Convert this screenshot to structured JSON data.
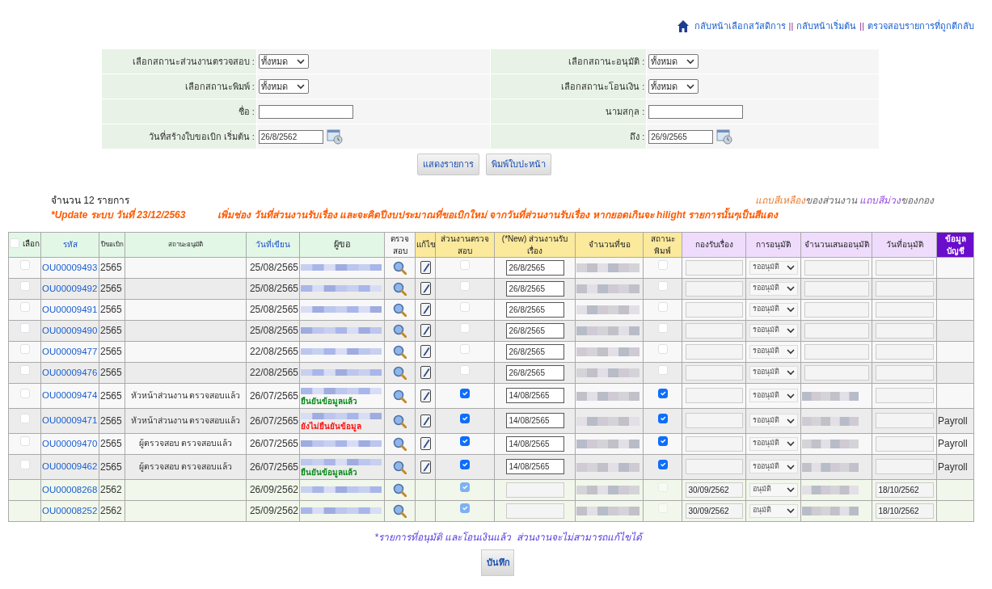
{
  "nav_links": [
    {
      "kind": "link",
      "label": "กลับหน้าเลือกสวัสดิการ"
    },
    {
      "kind": "sep",
      "label": "||"
    },
    {
      "kind": "link",
      "label": "กลับหน้าเริ่มต้น"
    },
    {
      "kind": "sep",
      "label": "||"
    },
    {
      "kind": "link",
      "label": "ตรวจสอบรายการที่ถูกตีกลับ"
    }
  ],
  "filters": [
    [
      {
        "label": "เลือกสถานะส่วนงานตรวจสอบ :",
        "kind": "select",
        "value": "ทั้งหมด"
      },
      {
        "label": "เลือกสถานะอนุมัติ :",
        "kind": "select",
        "value": "ทั้งหมด"
      }
    ],
    [
      {
        "label": "เลือกสถานะพิมพ์ :",
        "kind": "select",
        "value": "ทั้งหมด"
      },
      {
        "label": "เลือกสถานะโอนเงิน :",
        "kind": "select",
        "value": "ทั้งหมด"
      }
    ],
    [
      {
        "label": "ชื่อ :",
        "kind": "text"
      },
      {
        "label": "นามสกุล :",
        "kind": "text"
      }
    ],
    [
      {
        "label": "วันที่สร้างใบขอเบิก เริ่มต้น :",
        "kind": "date",
        "value": "26/8/2562"
      },
      {
        "label": "ถึง :",
        "kind": "date",
        "value": "26/9/2565"
      }
    ]
  ],
  "filter_buttons": [
    "แสดงรายการ",
    "พิมพ์ใบปะหน้า"
  ],
  "count": {
    "prefix": "จำนวน",
    "value": "12",
    "suffix": "รายการ"
  },
  "update_notice": {
    "date_text": "*Update ระบบ วันที่ 23/12/2563",
    "detail": "เพิ่มช่อง วันที่ส่วนงานรับเรื่อง และจะคิดปีงบประมาณที่ขอเบิกใหม่ จากวันที่ส่วนงานรับเรื่อง หากยอดเกินจะ hilight รายการนั้นๆเป็นสีแดง"
  },
  "legend": [
    {
      "text": "แถบสีเหลือง",
      "color": "#e8823a"
    },
    {
      "text": "ของส่วนงาน",
      "color": "#666666"
    },
    {
      "text": " แถบสีม่วง",
      "color": "#9a4fe0"
    },
    {
      "text": "ของกอง",
      "color": "#666666"
    }
  ],
  "table": {
    "columns": [
      {
        "label": "เลือก",
        "color": "#e3f7e6",
        "kind": "select_all",
        "checked": false
      },
      {
        "label": "รหัส",
        "color": "#e3f7e6",
        "kind": "link"
      },
      {
        "label": "ปีขอเบิก",
        "color": "#e3f7e6",
        "kind": "small"
      },
      {
        "label": "สถานะอนุมัติ",
        "color": "#e3f7e6",
        "kind": "small"
      },
      {
        "label": "วันที่เขียน",
        "color": "#e3f7e6",
        "kind": "link"
      },
      {
        "label": "ผู้ขอ",
        "color": "#e3f7e6",
        "kind": "plain"
      },
      {
        "label": "ตรวจสอบ",
        "color": "#f7f7f7",
        "kind": "plain"
      },
      {
        "label": "แก้ไข",
        "color": "#fbe99c",
        "kind": "plain"
      },
      {
        "label": "ส่วนงานตรวจสอบ",
        "color": "#fbe99c",
        "kind": "plain"
      },
      {
        "label": "(*New) ส่วนงานรับเรื่อง",
        "color": "#fbe99c",
        "kind": "plain"
      },
      {
        "label": "จำนวนที่ขอ",
        "color": "#fbe99c",
        "kind": "plain"
      },
      {
        "label": "สถานะพิมพ์",
        "color": "#fbe99c",
        "kind": "plain"
      },
      {
        "label": "กองรับเรื่อง",
        "color": "#efdcfd",
        "kind": "plain"
      },
      {
        "label": "การอนุมัติ",
        "color": "#efdcfd",
        "kind": "plain"
      },
      {
        "label": "จำนวนเสนออนุมัติ",
        "color": "#efdcfd",
        "kind": "plain"
      },
      {
        "label": "วันที่อนุมัติ",
        "color": "#efdcfd",
        "kind": "plain"
      },
      {
        "label": "ข้อมูลบัญชี",
        "color": "#6a0dcc",
        "kind": "dark"
      }
    ],
    "rows": [
      {
        "selected": false,
        "locked": false,
        "code": "OU00009493",
        "year": "2565",
        "date": "25/08/2565",
        "unit_checked": false,
        "received_date": "26/8/2565",
        "printed": false,
        "approval": "รออนุมัติ",
        "amount_redacted": false
      },
      {
        "selected": false,
        "locked": false,
        "code": "OU00009492",
        "year": "2565",
        "date": "25/08/2565",
        "unit_checked": false,
        "received_date": "26/8/2565",
        "printed": false,
        "approval": "รออนุมัติ",
        "amount_redacted": false
      },
      {
        "selected": false,
        "locked": false,
        "code": "OU00009491",
        "year": "2565",
        "date": "25/08/2565",
        "unit_checked": false,
        "received_date": "26/8/2565",
        "printed": false,
        "approval": "รออนุมัติ",
        "amount_redacted": false
      },
      {
        "selected": false,
        "locked": false,
        "code": "OU00009490",
        "year": "2565",
        "date": "25/08/2565",
        "unit_checked": false,
        "received_date": "26/8/2565",
        "printed": false,
        "approval": "รออนุมัติ",
        "amount_redacted": false
      },
      {
        "selected": false,
        "locked": false,
        "code": "OU00009477",
        "year": "2565",
        "date": "22/08/2565",
        "unit_checked": false,
        "received_date": "26/8/2565",
        "printed": false,
        "approval": "รออนุมัติ",
        "amount_redacted": false
      },
      {
        "selected": false,
        "locked": false,
        "code": "OU00009476",
        "year": "2565",
        "date": "22/08/2565",
        "unit_checked": false,
        "received_date": "26/8/2565",
        "printed": false,
        "approval": "รออนุมัติ",
        "amount_redacted": false
      },
      {
        "selected": false,
        "locked": false,
        "code": "OU00009474",
        "year": "2565",
        "status": "หัวหน้าส่วนงาน ตรวจสอบแล้ว",
        "date": "26/07/2565",
        "note": {
          "text": "ยืนยันข้อมูลแล้ว",
          "kind": "ok"
        },
        "unit_checked": true,
        "received_date": "14/08/2565",
        "printed": true,
        "approval": "รออนุมัติ",
        "amount_redacted": true
      },
      {
        "selected": false,
        "locked": false,
        "code": "OU00009471",
        "year": "2565",
        "status": "หัวหน้าส่วนงาน ตรวจสอบแล้ว",
        "date": "26/07/2565",
        "note": {
          "text": "ยังไม่ยืนยันข้อมูล",
          "kind": "warn"
        },
        "unit_checked": true,
        "received_date": "14/08/2565",
        "printed": true,
        "approval": "รออนุมัติ",
        "amount_redacted": true,
        "account": "Payroll"
      },
      {
        "selected": false,
        "locked": false,
        "code": "OU00009470",
        "year": "2565",
        "status": "ผู้ตรวจสอบ ตรวจสอบแล้ว",
        "date": "26/07/2565",
        "unit_checked": true,
        "received_date": "14/08/2565",
        "printed": true,
        "approval": "รออนุมัติ",
        "amount_redacted": true,
        "account": "Payroll"
      },
      {
        "selected": false,
        "locked": false,
        "code": "OU00009462",
        "year": "2565",
        "status": "ผู้ตรวจสอบ ตรวจสอบแล้ว",
        "date": "26/07/2565",
        "note": {
          "text": "ยืนยันข้อมูลแล้ว",
          "kind": "ok"
        },
        "unit_checked": true,
        "received_date": "14/08/2565",
        "printed": true,
        "approval": "รออนุมัติ",
        "amount_redacted": true,
        "account": "Payroll"
      },
      {
        "locked": true,
        "code": "OU00008268",
        "year": "2562",
        "date": "26/09/2562",
        "unit_checked": true,
        "printed": false,
        "fund_date": "30/09/2562",
        "approval": "อนุมัติ",
        "amount_redacted": true,
        "approved_date": "18/10/2562"
      },
      {
        "locked": true,
        "code": "OU00008252",
        "year": "2562",
        "date": "25/09/2562",
        "unit_checked": true,
        "printed": false,
        "fund_date": "30/09/2562",
        "approval": "อนุมัติ",
        "amount_redacted": true,
        "approved_date": "18/10/2562"
      }
    ]
  },
  "footer_note": "*รายการที่อนุมัติ และโอนเงินแล้ว  ส่วนงานจะไม่สามารถแก้ไขได้",
  "save_button": "บันทึก"
}
